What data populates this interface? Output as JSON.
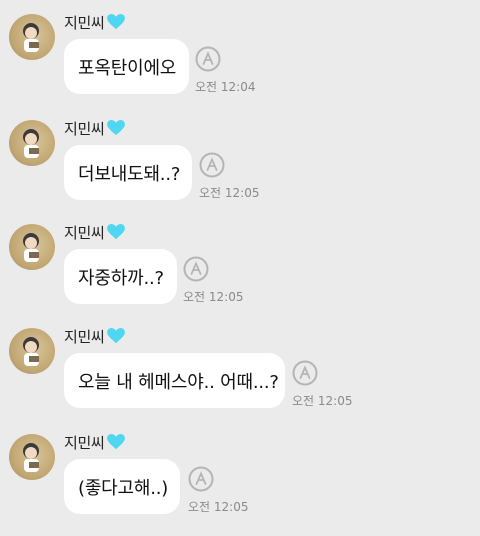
{
  "messages": [
    {
      "sender": "지민씨",
      "text": "포옥탄이에오",
      "time": "오전 12:04"
    },
    {
      "sender": "지민씨",
      "text": "더보내도돼..?",
      "time": "오전 12:05"
    },
    {
      "sender": "지민씨",
      "text": "자중하까..?",
      "time": "오전 12:05"
    },
    {
      "sender": "지민씨",
      "text": "오늘 내 헤메스야.. 어때...?",
      "time": "오전 12:05"
    },
    {
      "sender": "지민씨",
      "text": "(좋다고해..)",
      "time": "오전 12:05"
    }
  ],
  "colors": {
    "background": "#ebebeb",
    "bubble": "#ffffff",
    "heart": "#4fd6f0",
    "time": "#8a8a8a"
  },
  "icons": {
    "heart": "cyan-heart-icon",
    "read_status": "circled-a-icon"
  }
}
